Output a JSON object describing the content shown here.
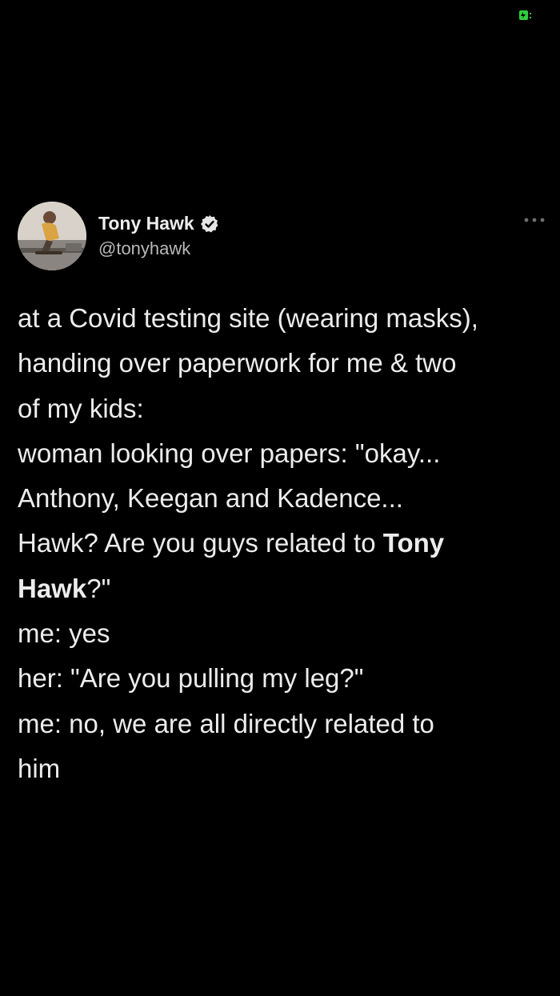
{
  "status_bar": {
    "icon": "battery-charging-icon",
    "accent": "#2ecc40"
  },
  "tweet": {
    "author": {
      "name": "Tony Hawk",
      "handle": "@tonyhawk",
      "verified": true,
      "avatar": "avatar-photo"
    },
    "more_icon": "more-options-icon",
    "lines": [
      "at a Covid testing site (wearing masks),",
      "handing over paperwork for me & two",
      "of my kids:",
      "woman looking over papers: \"okay...",
      "Anthony, Keegan and Kadence...",
      {
        "before": "Hawk? Are you guys related to ",
        "bold": "Tony"
      },
      {
        "bold": "Hawk",
        "after": "?\""
      },
      "me: yes",
      "her: \"Are you pulling my leg?\"",
      "me: no, we are all directly related to",
      "him"
    ]
  }
}
